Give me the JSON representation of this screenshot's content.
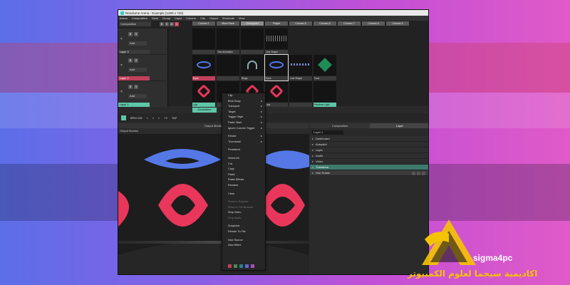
{
  "window": {
    "title": "Resolume Arena - Example (1280 x 720)"
  },
  "menu": [
    "Arena",
    "Composition",
    "Deck",
    "Group",
    "Layer",
    "Column",
    "Clip",
    "Output",
    "Shortcuts",
    "View"
  ],
  "composition": {
    "label": "Composition",
    "buttons": [
      "B",
      "S",
      "M",
      "O"
    ],
    "columns": [
      "Column 1",
      "Mirra Rave",
      "Geolopoed",
      "Fidget",
      "Column 5",
      "Column 6",
      "Column 7",
      "Column 8",
      "Column 9"
    ],
    "active_column": 2
  },
  "layers": [
    {
      "name": "Layer 3",
      "style": "dark",
      "b": "B",
      "s": "S",
      "add": "Add",
      "clips": [
        {
          "label": "",
          "style": "plain",
          "mark": "none"
        },
        {
          "label": "Text Animation",
          "style": "plain",
          "mark": "none"
        },
        {
          "label": "",
          "style": "plain",
          "mark": "none"
        },
        {
          "label": "Line Shape",
          "style": "plain",
          "mark": "lines2"
        }
      ]
    },
    {
      "name": "Layer 2",
      "style": "pink",
      "b": "B",
      "s": "S",
      "add": "Add",
      "clips": [
        {
          "label": "Eyes",
          "style": "pink",
          "mark": "blue"
        },
        {
          "label": "",
          "style": "plain",
          "mark": "none"
        },
        {
          "label": "Bingo",
          "style": "plain",
          "mark": "arc"
        },
        {
          "label": "Eyes",
          "style": "plain",
          "mark": "blue"
        },
        {
          "label": "Line Shape",
          "style": "plain",
          "mark": "lines"
        },
        {
          "label": "Fuzz",
          "style": "plain",
          "mark": "green"
        }
      ]
    },
    {
      "name": "Layer 1",
      "style": "teal",
      "b": "B",
      "s": "S",
      "add": "Add",
      "clips": [
        {
          "label": "Lips",
          "style": "teal",
          "mark": "red"
        },
        {
          "label": "",
          "style": "plain",
          "mark": "none"
        },
        {
          "label": "Waterfalls",
          "style": "plain",
          "mark": "red"
        },
        {
          "label": "Lips",
          "style": "plain",
          "mark": "red"
        },
        {
          "label": "",
          "style": "plain",
          "mark": "none"
        },
        {
          "label": "Rainbow Light",
          "style": "teal",
          "mark": "none"
        }
      ]
    }
  ],
  "generators_tab": "Generators",
  "transport": {
    "bpm_label": "BPM 128",
    "buttons": [
      "<",
      "«",
      "»",
      "+2",
      "TAP"
    ]
  },
  "output_monitor": {
    "title": "Output Monitor",
    "subtitle": "Output Monitor"
  },
  "right_panel": {
    "tabs": [
      "Composition",
      "Layer"
    ],
    "active_tab": 1,
    "search": "Layer 1",
    "items": [
      {
        "label": "Dashboard",
        "style": "plain"
      },
      {
        "label": "Autopilot",
        "style": "plain"
      },
      {
        "label": "Layer",
        "style": "plain"
      },
      {
        "label": "Audio",
        "style": "plain"
      },
      {
        "label": "Video",
        "style": "plain"
      },
      {
        "label": "Transform",
        "style": "teal"
      },
      {
        "label": "Hue Rotate",
        "style": "dark"
      }
    ]
  },
  "context_menu": {
    "items": [
      {
        "label": "Clip",
        "disabled": false,
        "sub": false,
        "sep_before": false
      },
      {
        "label": "Beat Snap",
        "disabled": false,
        "sub": true,
        "sep_before": false
      },
      {
        "label": "Transport",
        "disabled": false,
        "sub": true,
        "sep_before": false
      },
      {
        "label": "Target",
        "disabled": false,
        "sub": true,
        "sep_before": false
      },
      {
        "label": "Trigger Style",
        "disabled": false,
        "sub": true,
        "sep_before": false
      },
      {
        "label": "Fader Start",
        "disabled": false,
        "sub": true,
        "sep_before": false
      },
      {
        "label": "Ignore Column Trigger",
        "disabled": false,
        "sub": true,
        "sep_before": false
      },
      {
        "label": "Resize",
        "disabled": false,
        "sub": true,
        "sep_before": true
      },
      {
        "label": "Thumbnail",
        "disabled": false,
        "sub": true,
        "sep_before": false
      },
      {
        "label": "Persistent",
        "disabled": false,
        "sub": false,
        "sep_before": true
      },
      {
        "label": "Select All",
        "disabled": false,
        "sub": false,
        "sep_before": true
      },
      {
        "label": "Cut",
        "disabled": false,
        "sub": false,
        "sep_before": false
      },
      {
        "label": "Copy",
        "disabled": false,
        "sub": false,
        "sep_before": false
      },
      {
        "label": "Paste",
        "disabled": false,
        "sub": false,
        "sep_before": false
      },
      {
        "label": "Paste Effects",
        "disabled": false,
        "sub": false,
        "sep_before": false
      },
      {
        "label": "Rename",
        "disabled": false,
        "sub": false,
        "sep_before": false
      },
      {
        "label": "Clear",
        "disabled": false,
        "sub": false,
        "sep_before": true
      },
      {
        "label": "Show in Explorer",
        "disabled": true,
        "sub": false,
        "sep_before": true
      },
      {
        "label": "Show in File Browser",
        "disabled": true,
        "sub": false,
        "sep_before": false
      },
      {
        "label": "Strip Video",
        "disabled": false,
        "sub": false,
        "sep_before": false
      },
      {
        "label": "Strip Audio",
        "disabled": true,
        "sub": false,
        "sep_before": false
      },
      {
        "label": "Snapshot",
        "disabled": false,
        "sub": false,
        "sep_before": true
      },
      {
        "label": "Render To File",
        "disabled": false,
        "sub": false,
        "sep_before": false
      },
      {
        "label": "New Source",
        "disabled": false,
        "sub": false,
        "sep_before": true
      },
      {
        "label": "New Effect",
        "disabled": false,
        "sub": false,
        "sep_before": false
      }
    ],
    "swatches": [
      "#c0405a",
      "#4a8a4a",
      "#2e7e8e",
      "#5a6ad0",
      "#b04ab0"
    ]
  },
  "branding": {
    "name": "sigma4pc",
    "arabic": "اكاديمية سيجما لعلوم الكمبيوتر"
  },
  "colors": {
    "accent_teal": "#5fc6a8",
    "accent_pink": "#c0405a",
    "monitor_blue": "#5578e6",
    "monitor_red": "#e8375a",
    "brand_gold": "#f5c400"
  }
}
